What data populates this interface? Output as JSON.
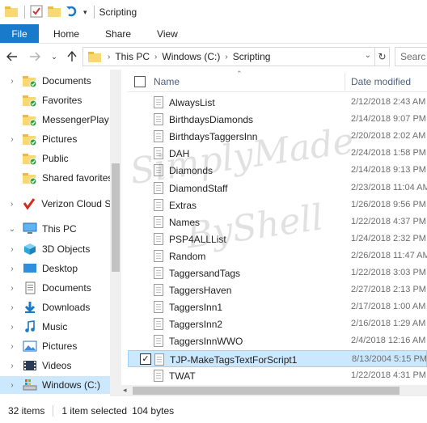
{
  "window": {
    "title": "Scripting"
  },
  "ribbon": {
    "tabs": [
      "File",
      "Home",
      "Share",
      "View"
    ]
  },
  "address": {
    "crumbs": [
      "This PC",
      "Windows (C:)",
      "Scripting"
    ],
    "search_placeholder": "Searc"
  },
  "navpane": {
    "items": [
      {
        "label": "Documents",
        "icon": "folder-sync-icon",
        "chevron": "›"
      },
      {
        "label": "Favorites",
        "icon": "folder-sync-icon",
        "chevron": ""
      },
      {
        "label": "MessengerPlay",
        "icon": "folder-sync-icon",
        "chevron": ""
      },
      {
        "label": "Pictures",
        "icon": "folder-sync-icon",
        "chevron": "›"
      },
      {
        "label": "Public",
        "icon": "folder-sync-icon",
        "chevron": ""
      },
      {
        "label": "Shared favorites",
        "icon": "folder-sync-icon",
        "chevron": ""
      },
      {
        "label": "Verizon Cloud Syn",
        "icon": "verizon-icon",
        "chevron": "›"
      },
      {
        "label": "This PC",
        "icon": "computer-icon",
        "chevron": "⌄"
      },
      {
        "label": "3D Objects",
        "icon": "cube-icon",
        "chevron": "›"
      },
      {
        "label": "Desktop",
        "icon": "desktop-icon",
        "chevron": "›"
      },
      {
        "label": "Documents",
        "icon": "documents-icon",
        "chevron": "›"
      },
      {
        "label": "Downloads",
        "icon": "download-icon",
        "chevron": "›"
      },
      {
        "label": "Music",
        "icon": "music-icon",
        "chevron": "›"
      },
      {
        "label": "Pictures",
        "icon": "pictures-icon",
        "chevron": "›"
      },
      {
        "label": "Videos",
        "icon": "videos-icon",
        "chevron": "›"
      },
      {
        "label": "Windows (C:)",
        "icon": "drive-icon",
        "chevron": "›"
      }
    ]
  },
  "columns": {
    "name": "Name",
    "date": "Date modified"
  },
  "files": [
    {
      "name": "AlwaysList",
      "date": "2/12/2018 2:43 AM",
      "selected": false
    },
    {
      "name": "BirthdaysDiamonds",
      "date": "2/14/2018 9:07 PM",
      "selected": false
    },
    {
      "name": "BirthdaysTaggersInn",
      "date": "2/20/2018 2:02 AM",
      "selected": false
    },
    {
      "name": "DAH",
      "date": "2/24/2018 1:58 PM",
      "selected": false
    },
    {
      "name": "Diamonds",
      "date": "2/14/2018 9:13 PM",
      "selected": false
    },
    {
      "name": "DiamondStaff",
      "date": "2/23/2018 11:04 AM",
      "selected": false
    },
    {
      "name": "Extras",
      "date": "1/26/2018 9:56 PM",
      "selected": false
    },
    {
      "name": "Names",
      "date": "1/22/2018 4:37 PM",
      "selected": false
    },
    {
      "name": "PSP4ALLList",
      "date": "1/24/2018 2:32 PM",
      "selected": false
    },
    {
      "name": "Random",
      "date": "2/26/2018 11:47 AM",
      "selected": false
    },
    {
      "name": "TaggersandTags",
      "date": "1/22/2018 3:03 PM",
      "selected": false
    },
    {
      "name": "TaggersHaven",
      "date": "2/27/2018 2:13 PM",
      "selected": false
    },
    {
      "name": "TaggersInn1",
      "date": "2/17/2018 1:00 AM",
      "selected": false
    },
    {
      "name": "TaggersInn2",
      "date": "2/16/2018 1:29 AM",
      "selected": false
    },
    {
      "name": "TaggersInnWWO",
      "date": "2/4/2018 12:16 AM",
      "selected": false
    },
    {
      "name": "TJP-MakeTagsTextForScript1",
      "date": "8/13/2004 5:15 PM",
      "selected": true
    },
    {
      "name": "TWAT",
      "date": "1/22/2018 4:31 PM",
      "selected": false
    }
  ],
  "status": {
    "count": "32 items",
    "selection": "1 item selected",
    "size": "104 bytes"
  },
  "watermark": {
    "line1": "SimplyMade",
    "line2": "ByShell"
  },
  "colors": {
    "accent": "#1979ca",
    "selection": "#cce8ff"
  }
}
